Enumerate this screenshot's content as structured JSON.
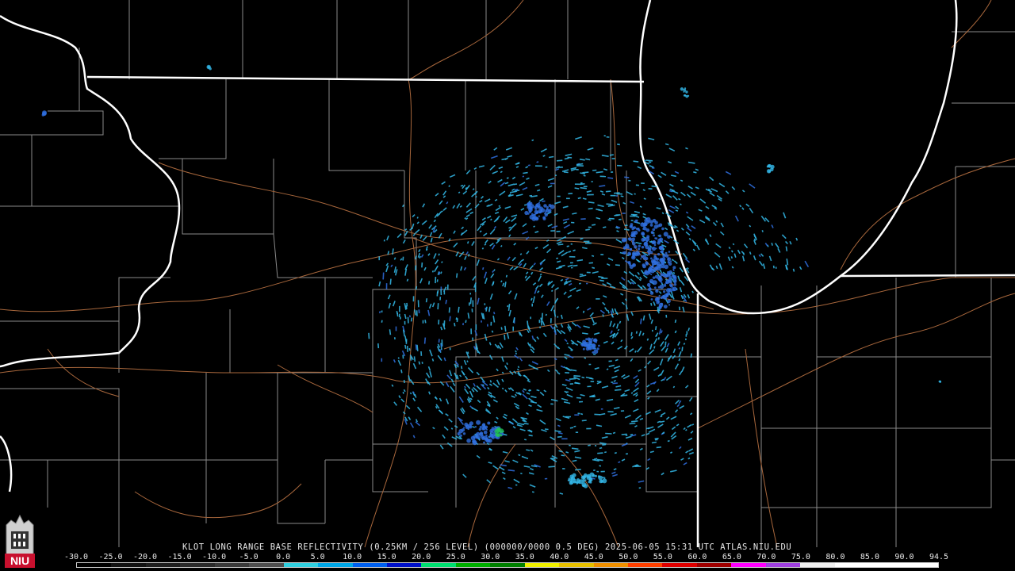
{
  "product": {
    "caption": "KLOT LONG RANGE BASE REFLECTIVITY (0.25KM / 256 LEVEL) (000000/0000 0.5 DEG) 2025-06-05 15:31 UTC  ATLAS.NIU.EDU"
  },
  "logo": {
    "text": "NIU",
    "color": "#c8102e"
  },
  "colors": {
    "background": "#000000",
    "state_borders": "#ffffff",
    "county_borders": "#8c8c8c",
    "highways": "#b06a3a",
    "echo_light": "#33b8e8",
    "echo_medium": "#2f6fe0",
    "echo_strong": "#22c05a"
  },
  "legend": {
    "unit_values": [
      "-30.0",
      "-25.0",
      "-20.0",
      "-15.0",
      "-10.0",
      "-5.0",
      "0.0",
      "5.0",
      "10.0",
      "15.0",
      "20.0",
      "25.0",
      "30.0",
      "35.0",
      "40.0",
      "45.0",
      "50.0",
      "55.0",
      "60.0",
      "65.0",
      "70.0",
      "75.0",
      "80.0",
      "85.0",
      "90.0",
      "94.5"
    ],
    "color_stops": [
      "#000000",
      "#111111",
      "#1e1e1e",
      "#2a2a2a",
      "#3a3a3a",
      "#4f4f4f",
      "#30d0e0",
      "#00a8e8",
      "#0060f0",
      "#0010c8",
      "#00e070",
      "#00b000",
      "#008000",
      "#f0f000",
      "#e8c000",
      "#f09000",
      "#ff4000",
      "#e00000",
      "#a00000",
      "#ff00ff",
      "#a040e0",
      "#f0f0f0",
      "#ffffff",
      "#ffffff",
      "#ffffff"
    ]
  }
}
